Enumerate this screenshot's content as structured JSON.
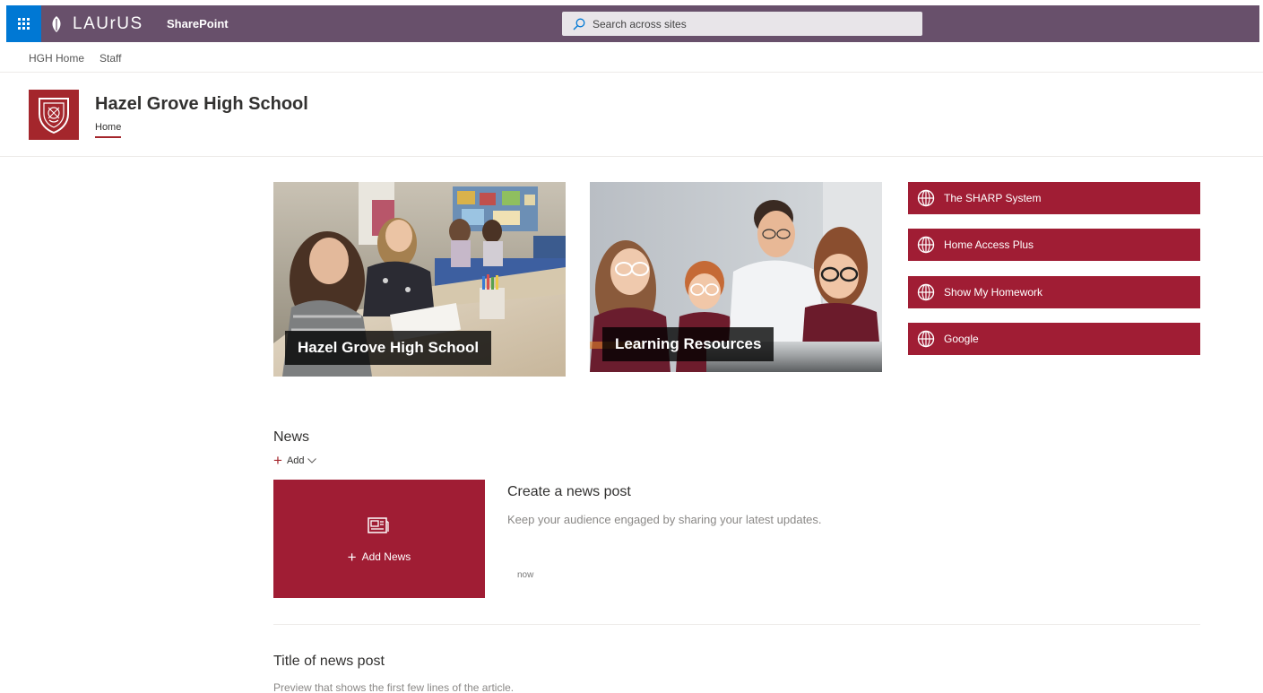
{
  "suite_bar": {
    "brand": "LAUrUS",
    "app_name": "SharePoint",
    "search_placeholder": "Search across sites",
    "colors": {
      "bar": "#68506b",
      "waffle": "#0078d4"
    }
  },
  "hub_nav": {
    "items": [
      {
        "label": "HGH Home"
      },
      {
        "label": "Staff"
      }
    ]
  },
  "site": {
    "title": "Hazel Grove High School",
    "nav": {
      "active": "Home"
    },
    "accent": "#a4262c"
  },
  "hero": [
    {
      "caption": "Hazel Grove High School"
    },
    {
      "caption": "Learning Resources"
    }
  ],
  "quick_links": [
    {
      "label": "The SHARP System",
      "icon": "globe-icon"
    },
    {
      "label": "Home Access Plus",
      "icon": "globe-icon"
    },
    {
      "label": "Show My Homework",
      "icon": "globe-icon"
    },
    {
      "label": "Google",
      "icon": "globe-icon"
    }
  ],
  "news": {
    "heading": "News",
    "add_label": "Add",
    "tile": {
      "label": "Add News",
      "icon": "news-icon"
    },
    "create": {
      "title": "Create a news post",
      "description": "Keep your audience engaged by sharing your latest updates.",
      "time": "now"
    },
    "post": {
      "title": "Title of news post",
      "preview": "Preview that shows the first few lines of the article."
    }
  }
}
